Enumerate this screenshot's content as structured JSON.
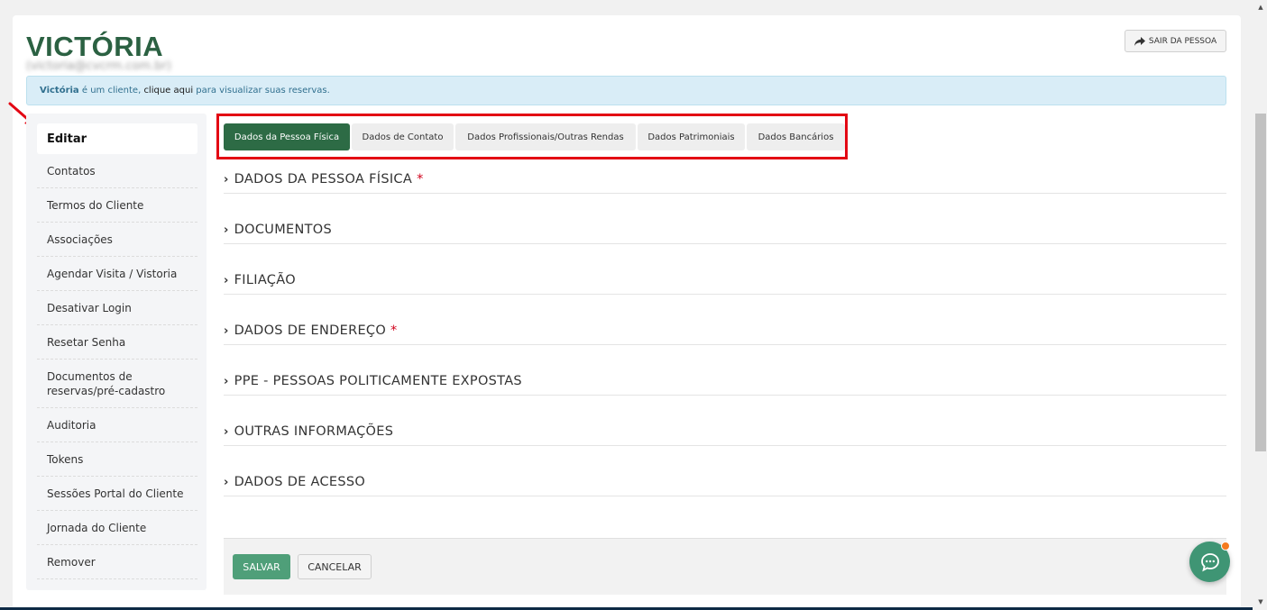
{
  "header": {
    "title": "VICTÓRIA",
    "email": "(victoria@cvcrm.com.br)",
    "exit_button": "SAIR DA PESSOA"
  },
  "info_bar": {
    "name": "Victória",
    "text1": " é um cliente, ",
    "link": "clique aqui",
    "text2": " para visualizar suas reservas."
  },
  "sidebar": {
    "items": [
      {
        "label": "Editar"
      },
      {
        "label": "Contatos"
      },
      {
        "label": "Termos do Cliente"
      },
      {
        "label": "Associações"
      },
      {
        "label": "Agendar Visita / Vistoria"
      },
      {
        "label": "Desativar Login"
      },
      {
        "label": "Resetar Senha"
      },
      {
        "label": "Documentos de reservas/pré-cadastro"
      },
      {
        "label": "Auditoria"
      },
      {
        "label": "Tokens"
      },
      {
        "label": "Sessões Portal do Cliente"
      },
      {
        "label": "Jornada do Cliente"
      },
      {
        "label": "Remover"
      }
    ]
  },
  "tabs": [
    {
      "label": "Dados da Pessoa Física"
    },
    {
      "label": "Dados de Contato"
    },
    {
      "label": "Dados Profissionais/Outras Rendas"
    },
    {
      "label": "Dados Patrimoniais"
    },
    {
      "label": "Dados Bancários"
    }
  ],
  "sections": [
    {
      "label": "DADOS DA PESSOA FÍSICA",
      "required": "*"
    },
    {
      "label": "DOCUMENTOS",
      "required": ""
    },
    {
      "label": "FILIAÇÃO",
      "required": ""
    },
    {
      "label": "DADOS DE ENDEREÇO",
      "required": "*"
    },
    {
      "label": "PPE - PESSOAS POLITICAMENTE EXPOSTAS",
      "required": ""
    },
    {
      "label": "OUTRAS INFORMAÇÕES",
      "required": ""
    },
    {
      "label": "DADOS DE ACESSO",
      "required": ""
    }
  ],
  "footer": {
    "save": "SALVAR",
    "cancel": "CANCELAR"
  },
  "colors": {
    "brand_green": "#2b6142",
    "active_tab": "#2d6b45",
    "save_button": "#4f9f79",
    "highlight_frame": "#e30613",
    "chat_button": "#3f9574"
  }
}
